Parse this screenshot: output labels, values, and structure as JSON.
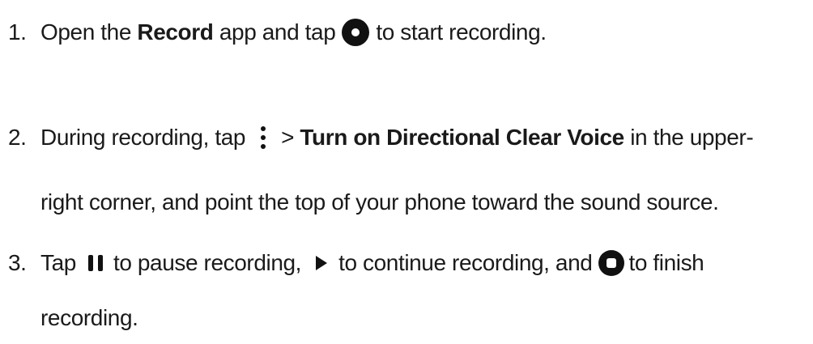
{
  "steps": [
    {
      "number": "1.",
      "line1": {
        "t1": "Open the ",
        "t2": "Record",
        "t3": " app and tap",
        "icon": "record-start-icon",
        "t4": "to start recording."
      }
    },
    {
      "number": "2.",
      "line1": {
        "t1": "During recording, tap",
        "icon": "more-vertical-icon",
        "t2": "> ",
        "t3": "Turn on Directional Clear Voice",
        "t4": " in the upper-"
      },
      "line2": {
        "t1": "right corner, and point the top of your phone toward the sound source."
      }
    },
    {
      "number": "3.",
      "line1": {
        "t1": "Tap",
        "icon_pause": "pause-icon",
        "t2": "to pause recording,",
        "icon_play": "play-icon",
        "t3": "to continue recording, and",
        "icon_stop": "stop-icon",
        "t4": "to finish"
      },
      "line2": {
        "t1": "recording."
      }
    }
  ],
  "colors": {
    "text": "#1a1a1a",
    "icon": "#111111",
    "background": "#ffffff"
  }
}
